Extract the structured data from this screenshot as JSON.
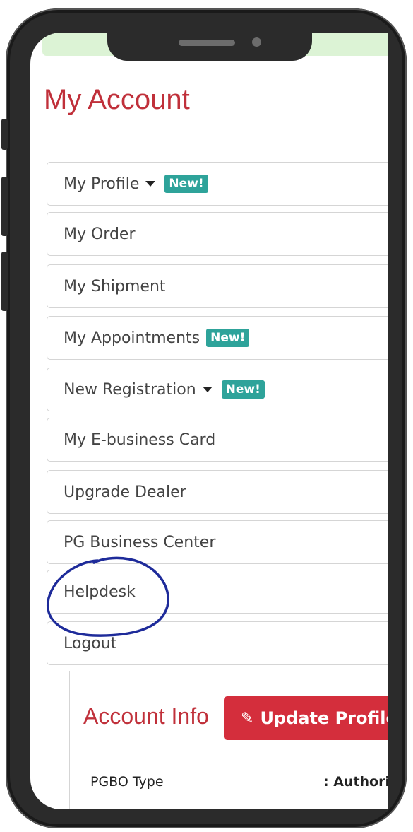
{
  "page_title": "My Account",
  "menu": [
    {
      "label": "My Profile",
      "dropdown": true,
      "badge": "New!"
    },
    {
      "label": "My Order"
    },
    {
      "label": "My Shipment"
    },
    {
      "label": "My Appointments",
      "badge": "New!"
    },
    {
      "label": "New Registration",
      "dropdown": true,
      "badge": "New!"
    },
    {
      "label": "My E-business Card"
    },
    {
      "label": "Upgrade Dealer"
    },
    {
      "label": "PG Business Center"
    },
    {
      "label": "Helpdesk"
    },
    {
      "label": "Logout"
    }
  ],
  "account_info": {
    "title": "Account Info",
    "update_button": "Update Profile",
    "fields": [
      {
        "label": "PGBO Type",
        "value": ": Authori"
      }
    ]
  },
  "colors": {
    "title_red": "#c0303a",
    "badge_teal": "#2ea39a",
    "button_red": "#d42e3c",
    "topbar_green": "#dcf3d5",
    "annotation_blue": "#1e2b9a"
  },
  "icons": {
    "dropdown": "caret-down-icon",
    "edit": "pencil-icon"
  }
}
